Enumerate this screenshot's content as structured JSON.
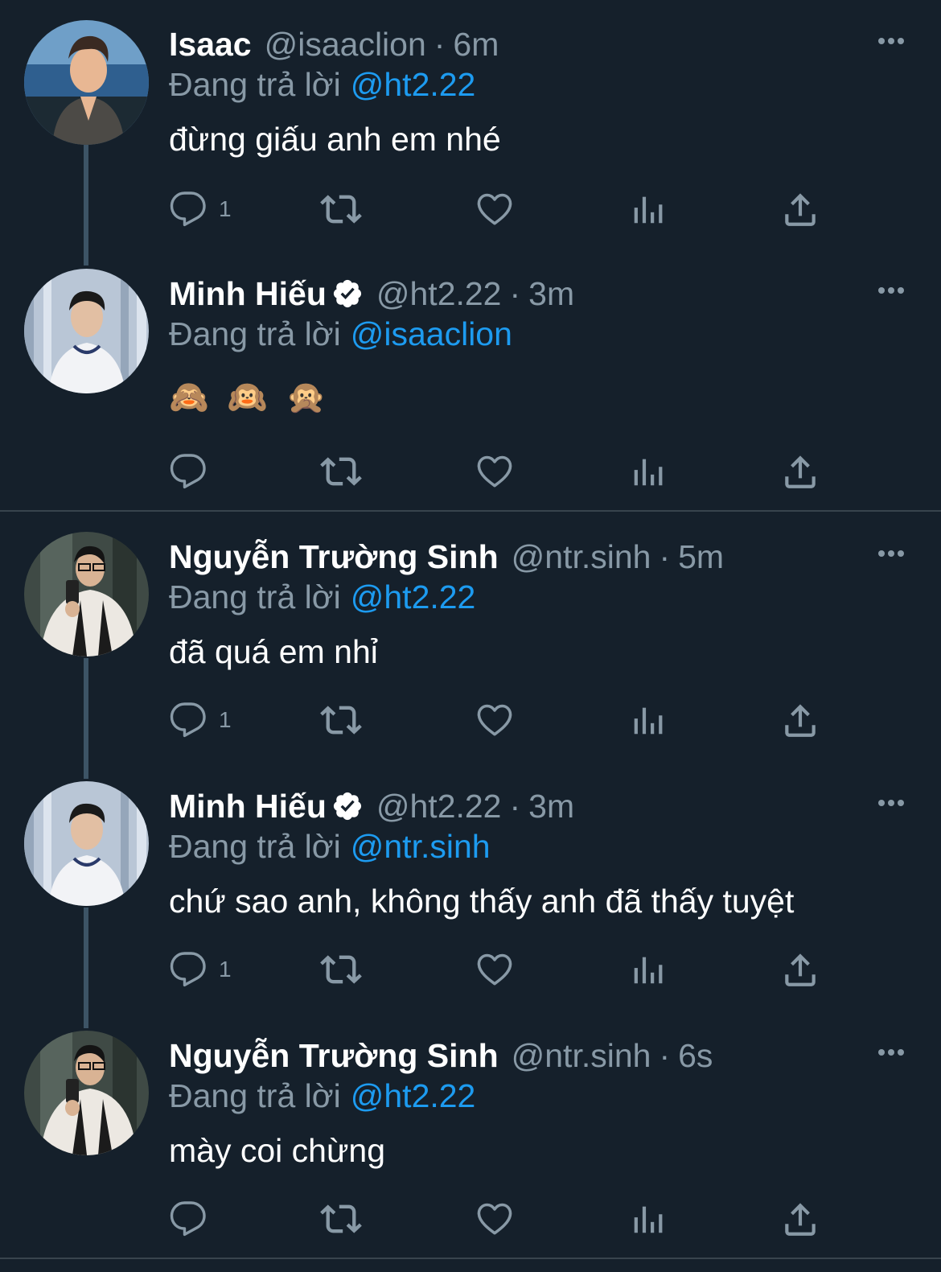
{
  "colors": {
    "background": "#15202b",
    "link": "#1d9bf0",
    "secondary_text": "#8899a6",
    "thread_line": "#3d5466",
    "divider": "#38444d"
  },
  "reply_prefix": "Đang trả lời",
  "tweets": [
    {
      "name": "Isaac",
      "verified": false,
      "handle": "@isaaclion",
      "sep": "·",
      "time": "6m",
      "reply_to": "@ht2.22",
      "text": "đừng giấu anh em nhé",
      "reply_count": "1",
      "avatar_icon": "avatar-isaac"
    },
    {
      "name": "Minh Hiếu",
      "verified": true,
      "handle": "@ht2.22",
      "sep": "·",
      "time": "3m",
      "reply_to": "@isaaclion",
      "text": "🙈 🙉 🙊",
      "reply_count": "",
      "avatar_icon": "avatar-minh-hieu"
    },
    {
      "name": "Nguyễn Trường Sinh",
      "verified": false,
      "handle": "@ntr.sinh",
      "sep": "·",
      "time": "5m",
      "reply_to": "@ht2.22",
      "text": "đã quá em nhỉ",
      "reply_count": "1",
      "avatar_icon": "avatar-nguyen-truong-sinh"
    },
    {
      "name": "Minh Hiếu",
      "verified": true,
      "handle": "@ht2.22",
      "sep": "·",
      "time": "3m",
      "reply_to": "@ntr.sinh",
      "text": "chứ sao anh, không thấy anh đã thấy tuyệt",
      "reply_count": "1",
      "avatar_icon": "avatar-minh-hieu"
    },
    {
      "name": "Nguyễn Trường Sinh",
      "verified": false,
      "handle": "@ntr.sinh",
      "sep": "·",
      "time": "6s",
      "reply_to": "@ht2.22",
      "text": "mày coi chừng",
      "reply_count": "",
      "avatar_icon": "avatar-nguyen-truong-sinh"
    }
  ]
}
